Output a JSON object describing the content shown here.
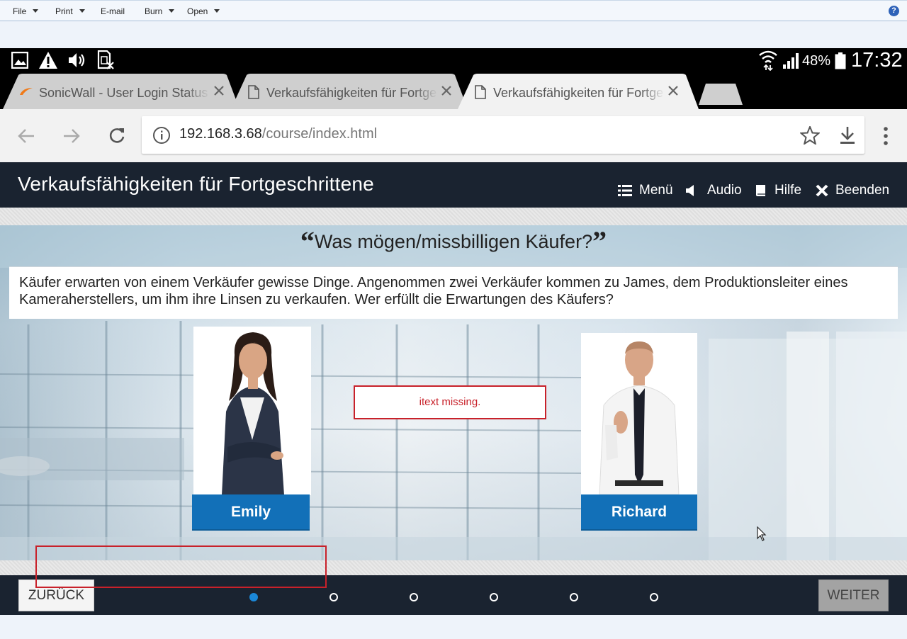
{
  "app_menu": {
    "items": [
      {
        "label": "File",
        "has_dropdown": true
      },
      {
        "label": "Print",
        "has_dropdown": true
      },
      {
        "label": "E-mail",
        "has_dropdown": false
      },
      {
        "label": "Burn",
        "has_dropdown": true
      },
      {
        "label": "Open",
        "has_dropdown": true
      }
    ],
    "help_label": "?"
  },
  "status_bar": {
    "battery": "48%",
    "time": "17:32",
    "icons": [
      "image-icon",
      "warning-icon",
      "volume-icon",
      "sim-off-icon",
      "wifi-icon",
      "signal-icon",
      "battery-icon"
    ]
  },
  "browser": {
    "tabs": [
      {
        "title": "SonicWall - User Login Status",
        "active": false,
        "favicon": "sonicwall-icon"
      },
      {
        "title": "Verkaufsfähigkeiten für Fortgeschrittene",
        "active": false,
        "favicon": "page-icon"
      },
      {
        "title": "Verkaufsfähigkeiten für Fortgeschrittene",
        "active": true,
        "favicon": "page-icon"
      }
    ],
    "url_host": "192.168.3.68",
    "url_path": "/course/index.html"
  },
  "course": {
    "title": "Verkaufsfähigkeiten für Fortgeschrittene",
    "nav": {
      "menu": "Menü",
      "audio": "Audio",
      "help": "Hilfe",
      "exit": "Beenden"
    },
    "heading": "Was mögen/missbilligen Käufer?",
    "quote_open": "“",
    "quote_close": "”",
    "question": "Käufer erwarten von einem Verkäufer gewisse Dinge. Angenommen zwei Verkäufer kommen zu James, dem Produktionsleiter eines Kameraherstellers, um ihm ihre Linsen zu verkaufen. Wer erfüllt die Erwartungen des Käufers?",
    "characters": [
      {
        "name": "Emily"
      },
      {
        "name": "Richard"
      }
    ],
    "missing_text": "itext missing.",
    "back_label": "ZURÜCK",
    "next_label": "WEITER",
    "progress": {
      "total": 6,
      "current": 1
    }
  },
  "colors": {
    "header_bg": "#1a2330",
    "button_blue": "#1270b8",
    "active_dot": "#1b88d8",
    "error_red": "#c8212a"
  }
}
